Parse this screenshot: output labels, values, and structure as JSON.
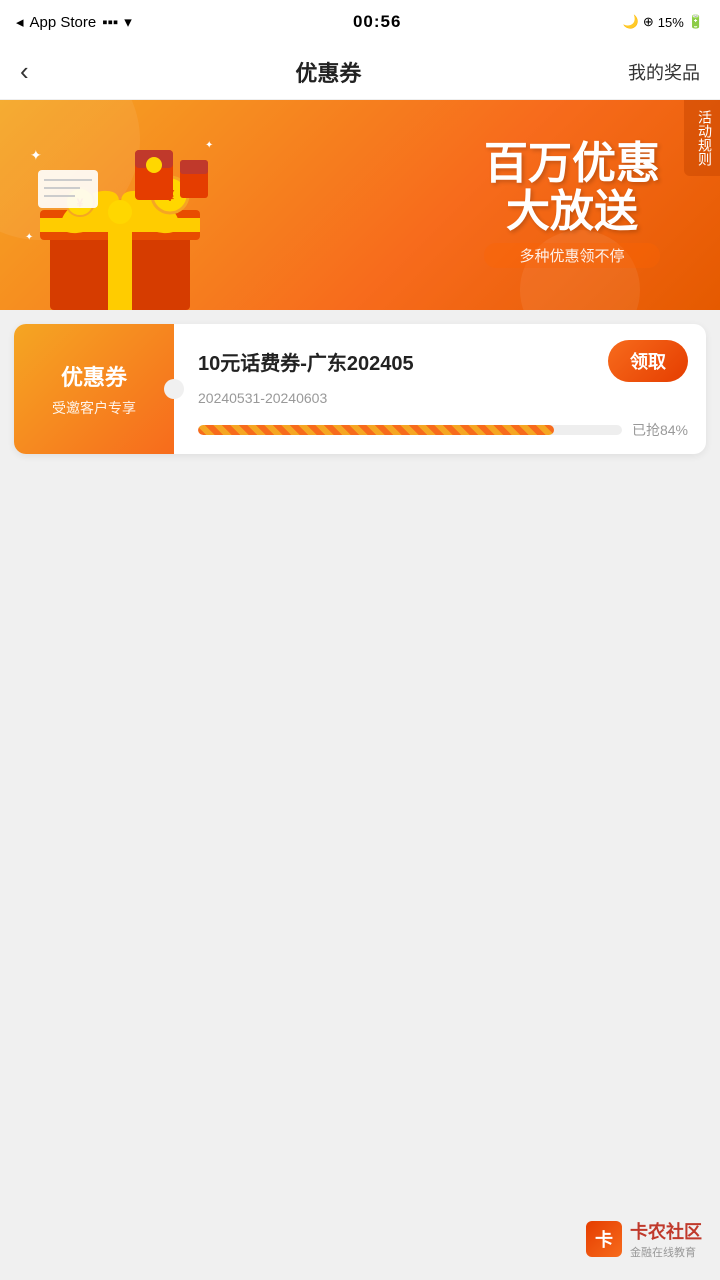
{
  "statusBar": {
    "carrier": "App Store",
    "time": "00:56",
    "battery": "15%"
  },
  "navBar": {
    "backLabel": "‹",
    "title": "优惠券",
    "rightLabel": "我的奖品"
  },
  "banner": {
    "mainTitle": "百万优惠",
    "subTitle1": "大放送",
    "subTitle2": "多种优惠领不停",
    "rulesLabel": "活动规则"
  },
  "coupons": [
    {
      "leftTitle": "优惠券",
      "leftDesc": "受邀客户专享",
      "name": "10元话费券-广东202405",
      "date": "20240531-20240603",
      "claimLabel": "领取",
      "progressPercent": 84,
      "progressLabel": "已抢84%"
    }
  ],
  "watermark": {
    "iconText": "卡",
    "mainText": "卡农社区",
    "subText": "金融在线教育"
  }
}
